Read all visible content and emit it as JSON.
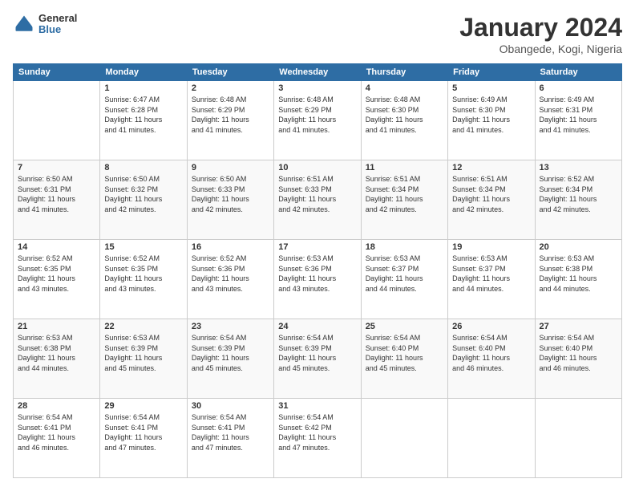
{
  "logo": {
    "line1": "General",
    "line2": "Blue"
  },
  "title": "January 2024",
  "location": "Obangede, Kogi, Nigeria",
  "weekdays": [
    "Sunday",
    "Monday",
    "Tuesday",
    "Wednesday",
    "Thursday",
    "Friday",
    "Saturday"
  ],
  "weeks": [
    [
      {
        "day": "",
        "info": ""
      },
      {
        "day": "1",
        "info": "Sunrise: 6:47 AM\nSunset: 6:28 PM\nDaylight: 11 hours\nand 41 minutes."
      },
      {
        "day": "2",
        "info": "Sunrise: 6:48 AM\nSunset: 6:29 PM\nDaylight: 11 hours\nand 41 minutes."
      },
      {
        "day": "3",
        "info": "Sunrise: 6:48 AM\nSunset: 6:29 PM\nDaylight: 11 hours\nand 41 minutes."
      },
      {
        "day": "4",
        "info": "Sunrise: 6:48 AM\nSunset: 6:30 PM\nDaylight: 11 hours\nand 41 minutes."
      },
      {
        "day": "5",
        "info": "Sunrise: 6:49 AM\nSunset: 6:30 PM\nDaylight: 11 hours\nand 41 minutes."
      },
      {
        "day": "6",
        "info": "Sunrise: 6:49 AM\nSunset: 6:31 PM\nDaylight: 11 hours\nand 41 minutes."
      }
    ],
    [
      {
        "day": "7",
        "info": "Sunrise: 6:50 AM\nSunset: 6:31 PM\nDaylight: 11 hours\nand 41 minutes."
      },
      {
        "day": "8",
        "info": "Sunrise: 6:50 AM\nSunset: 6:32 PM\nDaylight: 11 hours\nand 42 minutes."
      },
      {
        "day": "9",
        "info": "Sunrise: 6:50 AM\nSunset: 6:33 PM\nDaylight: 11 hours\nand 42 minutes."
      },
      {
        "day": "10",
        "info": "Sunrise: 6:51 AM\nSunset: 6:33 PM\nDaylight: 11 hours\nand 42 minutes."
      },
      {
        "day": "11",
        "info": "Sunrise: 6:51 AM\nSunset: 6:34 PM\nDaylight: 11 hours\nand 42 minutes."
      },
      {
        "day": "12",
        "info": "Sunrise: 6:51 AM\nSunset: 6:34 PM\nDaylight: 11 hours\nand 42 minutes."
      },
      {
        "day": "13",
        "info": "Sunrise: 6:52 AM\nSunset: 6:34 PM\nDaylight: 11 hours\nand 42 minutes."
      }
    ],
    [
      {
        "day": "14",
        "info": "Sunrise: 6:52 AM\nSunset: 6:35 PM\nDaylight: 11 hours\nand 43 minutes."
      },
      {
        "day": "15",
        "info": "Sunrise: 6:52 AM\nSunset: 6:35 PM\nDaylight: 11 hours\nand 43 minutes."
      },
      {
        "day": "16",
        "info": "Sunrise: 6:52 AM\nSunset: 6:36 PM\nDaylight: 11 hours\nand 43 minutes."
      },
      {
        "day": "17",
        "info": "Sunrise: 6:53 AM\nSunset: 6:36 PM\nDaylight: 11 hours\nand 43 minutes."
      },
      {
        "day": "18",
        "info": "Sunrise: 6:53 AM\nSunset: 6:37 PM\nDaylight: 11 hours\nand 44 minutes."
      },
      {
        "day": "19",
        "info": "Sunrise: 6:53 AM\nSunset: 6:37 PM\nDaylight: 11 hours\nand 44 minutes."
      },
      {
        "day": "20",
        "info": "Sunrise: 6:53 AM\nSunset: 6:38 PM\nDaylight: 11 hours\nand 44 minutes."
      }
    ],
    [
      {
        "day": "21",
        "info": "Sunrise: 6:53 AM\nSunset: 6:38 PM\nDaylight: 11 hours\nand 44 minutes."
      },
      {
        "day": "22",
        "info": "Sunrise: 6:53 AM\nSunset: 6:39 PM\nDaylight: 11 hours\nand 45 minutes."
      },
      {
        "day": "23",
        "info": "Sunrise: 6:54 AM\nSunset: 6:39 PM\nDaylight: 11 hours\nand 45 minutes."
      },
      {
        "day": "24",
        "info": "Sunrise: 6:54 AM\nSunset: 6:39 PM\nDaylight: 11 hours\nand 45 minutes."
      },
      {
        "day": "25",
        "info": "Sunrise: 6:54 AM\nSunset: 6:40 PM\nDaylight: 11 hours\nand 45 minutes."
      },
      {
        "day": "26",
        "info": "Sunrise: 6:54 AM\nSunset: 6:40 PM\nDaylight: 11 hours\nand 46 minutes."
      },
      {
        "day": "27",
        "info": "Sunrise: 6:54 AM\nSunset: 6:40 PM\nDaylight: 11 hours\nand 46 minutes."
      }
    ],
    [
      {
        "day": "28",
        "info": "Sunrise: 6:54 AM\nSunset: 6:41 PM\nDaylight: 11 hours\nand 46 minutes."
      },
      {
        "day": "29",
        "info": "Sunrise: 6:54 AM\nSunset: 6:41 PM\nDaylight: 11 hours\nand 47 minutes."
      },
      {
        "day": "30",
        "info": "Sunrise: 6:54 AM\nSunset: 6:41 PM\nDaylight: 11 hours\nand 47 minutes."
      },
      {
        "day": "31",
        "info": "Sunrise: 6:54 AM\nSunset: 6:42 PM\nDaylight: 11 hours\nand 47 minutes."
      },
      {
        "day": "",
        "info": ""
      },
      {
        "day": "",
        "info": ""
      },
      {
        "day": "",
        "info": ""
      }
    ]
  ]
}
